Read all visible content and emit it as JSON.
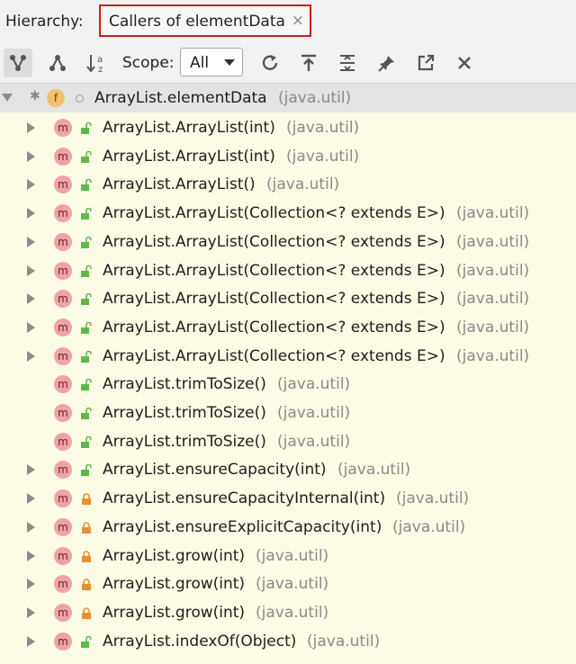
{
  "header": {
    "hierarchy_label": "Hierarchy:",
    "tab_title": "Callers of elementData",
    "tab_close": "×"
  },
  "toolbar": {
    "scope_label": "Scope:",
    "scope_value": "All",
    "buttons": [
      "callers-hierarchy-icon",
      "callees-hierarchy-icon",
      "sort-alpha-icon",
      "refresh-icon",
      "export-icon",
      "expand-all-icon",
      "pin-icon",
      "open-external-icon",
      "close-icon"
    ]
  },
  "root": {
    "name": "ArrayList.elementData",
    "pkg": "(java.util)",
    "badge": "f"
  },
  "rows": [
    {
      "name": "ArrayList.ArrayList(int)",
      "pkg": "(java.util)",
      "expand": true,
      "lock": "open"
    },
    {
      "name": "ArrayList.ArrayList(int)",
      "pkg": "(java.util)",
      "expand": true,
      "lock": "open"
    },
    {
      "name": "ArrayList.ArrayList()",
      "pkg": "(java.util)",
      "expand": true,
      "lock": "open"
    },
    {
      "name": "ArrayList.ArrayList(Collection<? extends E>)",
      "pkg": "(java.util)",
      "expand": true,
      "lock": "open"
    },
    {
      "name": "ArrayList.ArrayList(Collection<? extends E>)",
      "pkg": "(java.util)",
      "expand": true,
      "lock": "open"
    },
    {
      "name": "ArrayList.ArrayList(Collection<? extends E>)",
      "pkg": "(java.util)",
      "expand": true,
      "lock": "open"
    },
    {
      "name": "ArrayList.ArrayList(Collection<? extends E>)",
      "pkg": "(java.util)",
      "expand": true,
      "lock": "open"
    },
    {
      "name": "ArrayList.ArrayList(Collection<? extends E>)",
      "pkg": "(java.util)",
      "expand": true,
      "lock": "open"
    },
    {
      "name": "ArrayList.ArrayList(Collection<? extends E>)",
      "pkg": "(java.util)",
      "expand": true,
      "lock": "open"
    },
    {
      "name": "ArrayList.trimToSize()",
      "pkg": "(java.util)",
      "expand": false,
      "lock": "open"
    },
    {
      "name": "ArrayList.trimToSize()",
      "pkg": "(java.util)",
      "expand": false,
      "lock": "open"
    },
    {
      "name": "ArrayList.trimToSize()",
      "pkg": "(java.util)",
      "expand": false,
      "lock": "open"
    },
    {
      "name": "ArrayList.ensureCapacity(int)",
      "pkg": "(java.util)",
      "expand": true,
      "lock": "open"
    },
    {
      "name": "ArrayList.ensureCapacityInternal(int)",
      "pkg": "(java.util)",
      "expand": true,
      "lock": "closed"
    },
    {
      "name": "ArrayList.ensureExplicitCapacity(int)",
      "pkg": "(java.util)",
      "expand": true,
      "lock": "closed"
    },
    {
      "name": "ArrayList.grow(int)",
      "pkg": "(java.util)",
      "expand": true,
      "lock": "closed"
    },
    {
      "name": "ArrayList.grow(int)",
      "pkg": "(java.util)",
      "expand": true,
      "lock": "closed"
    },
    {
      "name": "ArrayList.grow(int)",
      "pkg": "(java.util)",
      "expand": true,
      "lock": "closed"
    },
    {
      "name": "ArrayList.indexOf(Object)",
      "pkg": "(java.util)",
      "expand": true,
      "lock": "open"
    }
  ],
  "colors": {
    "open_lock": "#5fb84a",
    "closed_lock": "#e8902f",
    "highlight": "#c81e1e"
  }
}
